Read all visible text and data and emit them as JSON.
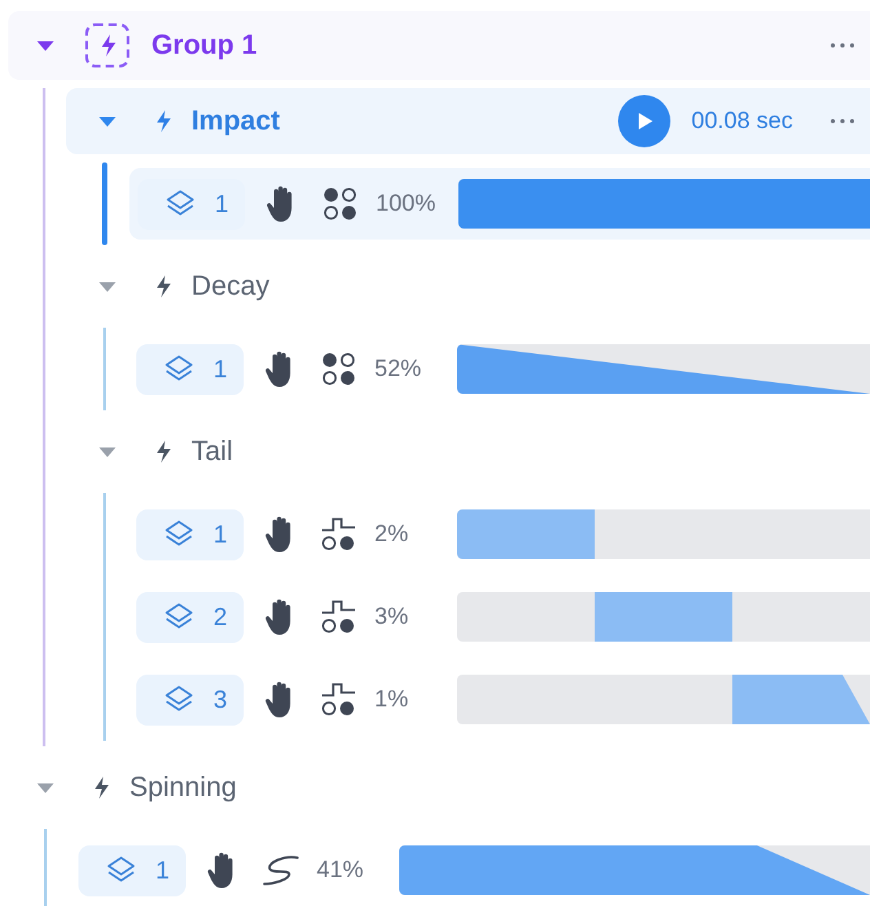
{
  "tree": [
    {
      "kind": "group",
      "title": "Group 1",
      "expanded": true,
      "children": [
        {
          "kind": "effect",
          "title": "Impact",
          "expanded": true,
          "selected": true,
          "duration": "00.08 sec",
          "layers": [
            {
              "number": "1",
              "pattern": {
                "kind": "dots"
              },
              "percent": "100%",
              "kind": "full",
              "selected": true
            }
          ]
        },
        {
          "kind": "effect",
          "title": "Decay",
          "expanded": true,
          "selected": false,
          "layers": [
            {
              "number": "1",
              "pattern": {
                "kind": "dots"
              },
              "percent": "52%",
              "kind": "fade",
              "selected": false
            }
          ]
        },
        {
          "kind": "effect",
          "title": "Tail",
          "expanded": true,
          "selected": false,
          "layers": [
            {
              "number": "1",
              "pattern": {
                "kind": "step"
              },
              "percent": "2%",
              "kind": "block",
              "selected": false
            },
            {
              "number": "2",
              "pattern": {
                "kind": "step"
              },
              "percent": "3%",
              "kind": "block",
              "selected": false
            },
            {
              "number": "3",
              "pattern": {
                "kind": "step"
              },
              "percent": "1%",
              "kind": "block",
              "selected": false
            }
          ]
        }
      ]
    },
    {
      "kind": "effect",
      "title": "Spinning",
      "expanded": true,
      "selected": false,
      "layers": [
        {
          "number": "1",
          "pattern": {
            "kind": "curve"
          },
          "percent": "41%",
          "kind": "hold-fade",
          "selected": false
        }
      ]
    }
  ]
}
